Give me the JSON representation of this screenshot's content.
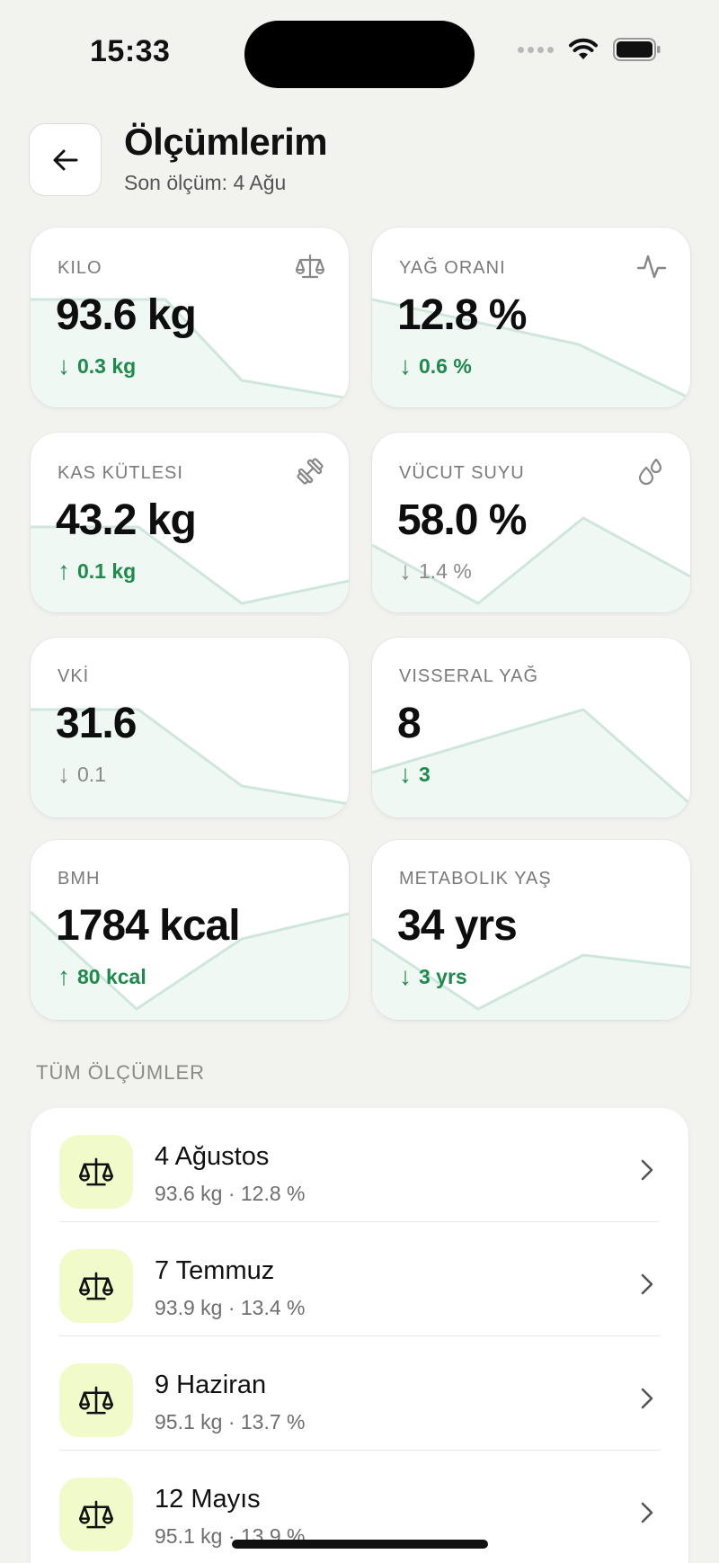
{
  "status_bar": {
    "time": "15:33"
  },
  "header": {
    "title": "Ölçümlerim",
    "subtitle": "Son ölçüm: 4 Ağu"
  },
  "metrics": [
    {
      "label": "KILO",
      "value": "93.6 kg",
      "delta": "0.3 kg",
      "direction": "down",
      "tone": "good",
      "icon": "scale-icon"
    },
    {
      "label": "YAĞ ORANI",
      "value": "12.8 %",
      "delta": "0.6 %",
      "direction": "down",
      "tone": "good",
      "icon": "activity-icon"
    },
    {
      "label": "KAS KÜTLESI",
      "value": "43.2 kg",
      "delta": "0.1 kg",
      "direction": "up",
      "tone": "good",
      "icon": "dumbbell-icon"
    },
    {
      "label": "VÜCUT SUYU",
      "value": "58.0 %",
      "delta": "1.4 %",
      "direction": "down",
      "tone": "neutral",
      "icon": "droplets-icon"
    },
    {
      "label": "VKİ",
      "value": "31.6",
      "delta": "0.1",
      "direction": "down",
      "tone": "neutral",
      "icon": ""
    },
    {
      "label": "VISSERAL YAĞ",
      "value": "8",
      "delta": "3",
      "direction": "down",
      "tone": "good",
      "icon": ""
    },
    {
      "label": "BMH",
      "value": "1784 kcal",
      "delta": "80 kcal",
      "direction": "up",
      "tone": "good",
      "icon": ""
    },
    {
      "label": "METABOLIK YAŞ",
      "value": "34 yrs",
      "delta": "3 yrs",
      "direction": "down",
      "tone": "good",
      "icon": ""
    }
  ],
  "section": {
    "title": "TÜM ÖLÇÜMLER"
  },
  "measurements": [
    {
      "date": "4 Ağustos",
      "summary": "93.6 kg · 12.8 %"
    },
    {
      "date": "7 Temmuz",
      "summary": "93.9 kg · 13.4 %"
    },
    {
      "date": "9 Haziran",
      "summary": "95.1 kg · 13.7 %"
    },
    {
      "date": "12 Mayıs",
      "summary": "95.1 kg · 13.9 %"
    }
  ],
  "colors": {
    "good": "#1e8a4c",
    "neutral": "#8a8a88",
    "spark": "#cfe6dd",
    "icon_bg": "#f0fbc9"
  },
  "arrows": {
    "up": "↑",
    "down": "↓"
  }
}
